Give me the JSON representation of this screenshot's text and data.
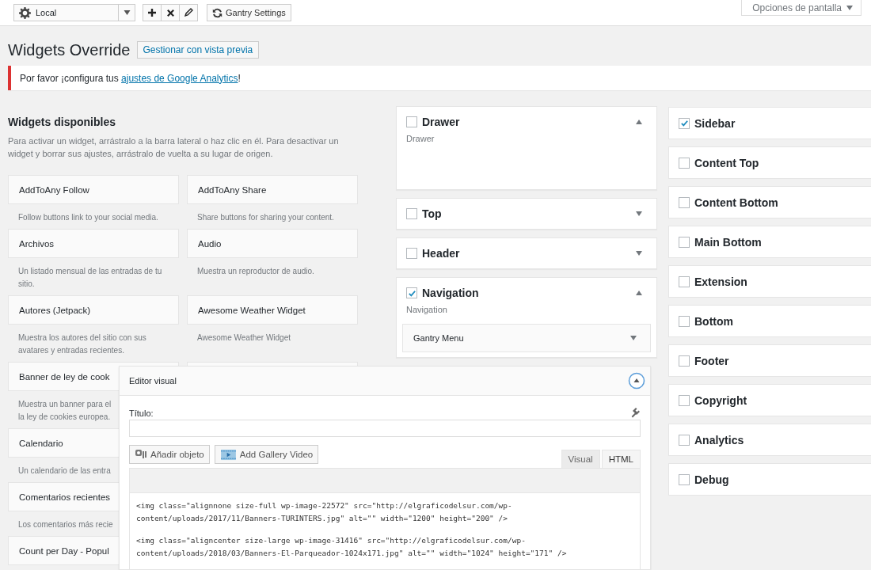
{
  "toolbar": {
    "selector": {
      "value": "Local"
    },
    "buttons": [
      {
        "kind": "add"
      },
      {
        "kind": "delete"
      },
      {
        "kind": "edit"
      }
    ],
    "settings_button": "Gantry Settings",
    "screen_options": "Opciones de pantalla"
  },
  "header": {
    "title": "Widgets Override",
    "button": "Gestionar con vista previa"
  },
  "notice": {
    "text": "Por favor ¡configura tus ",
    "link": "ajustes de Google Analytics",
    "suffix": "!"
  },
  "available": {
    "title": "Widgets disponibles",
    "description": "Para activar un widget, arrástralo a la barra lateral o haz clic en él. Para desactivar un widget y borrar sus ajustes, arrástralo de vuelta a su lugar de origen.",
    "rows": [
      {
        "cells": [
          {
            "title": "AddToAny Follow",
            "description": [
              "Follow buttons link to your social media."
            ]
          },
          {
            "title": "AddToAny Share",
            "description": [
              "Share buttons for sharing your content."
            ]
          }
        ]
      },
      {
        "cells": [
          {
            "title": "Archivos",
            "description": [
              "Un listado mensual de las entradas de tu",
              "sitio."
            ]
          },
          {
            "title": "Audio",
            "description": [
              "Muestra un reproductor de audio."
            ]
          }
        ]
      },
      {
        "cells": [
          {
            "title": "Autores (Jetpack)",
            "description": [
              "Muestra los autores del sitio con sus",
              "avatares y entradas recientes."
            ]
          },
          {
            "title": "Awesome Weather Widget",
            "description": [
              "Awesome Weather Widget"
            ]
          }
        ]
      },
      {
        "cells": [
          {
            "title": "Banner de ley de cook",
            "description": [
              "Muestra un banner para el",
              "la ley de cookies europea."
            ]
          },
          {}
        ]
      },
      {
        "cells": [
          {
            "title": "Calendario",
            "description": [
              "Un calendario de las entra"
            ]
          }
        ]
      },
      {
        "cells": [
          {
            "title": "Comentarios recientes",
            "description": [
              "Los comentarios más recie"
            ]
          }
        ]
      },
      {
        "cells": [
          {
            "title": "Count per Day - Popul"
          }
        ]
      }
    ]
  },
  "sidebars_middle": [
    {
      "title": "Drawer",
      "checked": false,
      "expanded": true,
      "description": "Drawer"
    },
    {
      "title": "Top",
      "checked": false,
      "expanded": false
    },
    {
      "title": "Header",
      "checked": false,
      "expanded": false
    },
    {
      "title": "Navigation",
      "checked": true,
      "expanded": true,
      "description": "Navigation",
      "widgets": [
        "Gantry Menu"
      ]
    }
  ],
  "sidebars_right": [
    {
      "title": "Sidebar",
      "checked": true
    },
    {
      "title": "Content Top",
      "checked": false
    },
    {
      "title": "Content Bottom",
      "checked": false
    },
    {
      "title": "Main Bottom",
      "checked": false
    },
    {
      "title": "Extension",
      "checked": false
    },
    {
      "title": "Bottom",
      "checked": false
    },
    {
      "title": "Footer",
      "checked": false
    },
    {
      "title": "Copyright",
      "checked": false
    },
    {
      "title": "Analytics",
      "checked": false
    },
    {
      "title": "Debug",
      "checked": false
    }
  ],
  "editor": {
    "title": "Editor visual",
    "field_label": "Título:",
    "buttons": [
      {
        "kind": "media",
        "label": "Añadir objeto"
      },
      {
        "kind": "video",
        "label": "Add Gallery Video"
      }
    ],
    "tabs": [
      {
        "label": "Visual",
        "selected": false
      },
      {
        "label": "HTML",
        "selected": true
      }
    ],
    "code": [
      [
        "<img class=\"alignnone size-full wp-image-22572\" src=\"http://elgraficodelsur.com/wp-",
        "content/uploads/2017/11/Banners-TURINTERS.jpg\" alt=\"\" width=\"1200\" height=\"200\" />"
      ],
      [
        "<img class=\"aligncenter size-large wp-image-31416\" src=\"http://elgraficodelsur.com/wp-",
        "content/uploads/2018/03/Banners-El-Parqueador-1024x171.jpg\" alt=\"\" width=\"1024\" height=\"171\" />"
      ]
    ]
  }
}
